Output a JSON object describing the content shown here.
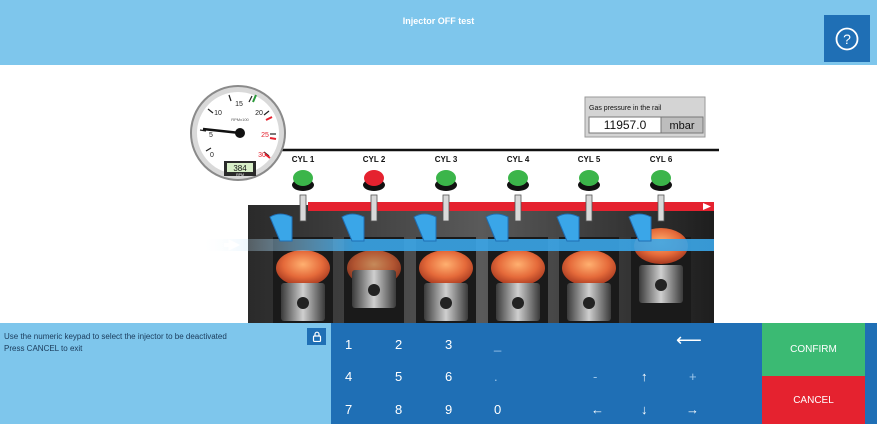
{
  "header": {
    "title": "Injector OFF test",
    "help_icon": "question-mark-icon"
  },
  "gauge": {
    "unit_label": "RPMx100",
    "rpm_label": "RPM",
    "rpm_value": "384",
    "ticks": [
      "0",
      "5",
      "10",
      "15",
      "20",
      "25",
      "30"
    ]
  },
  "pressure": {
    "label": "Gas pressure in the rail",
    "value": "11957.0",
    "unit": "mbar"
  },
  "cylinders": [
    {
      "label": "CYL 1",
      "status_color": "#3bb54a"
    },
    {
      "label": "CYL 2",
      "status_color": "#e5222f"
    },
    {
      "label": "CYL 3",
      "status_color": "#3bb54a"
    },
    {
      "label": "CYL 4",
      "status_color": "#3bb54a"
    },
    {
      "label": "CYL 5",
      "status_color": "#3bb54a"
    },
    {
      "label": "CYL 6",
      "status_color": "#3bb54a"
    }
  ],
  "instructions": {
    "line1": "Use the numeric keypad to select the injector to be deactivated",
    "line2": "Press CANCEL to exit",
    "lock_icon": "lock-icon"
  },
  "keypad": {
    "row1": [
      "1",
      "2",
      "3",
      "_"
    ],
    "row2": [
      "4",
      "5",
      "6",
      ".",
      "-",
      "↑",
      "+"
    ],
    "row3": [
      "7",
      "8",
      "9",
      "0",
      "←",
      "↓",
      "→"
    ],
    "backspace": "⟵"
  },
  "actions": {
    "confirm": "CONFIRM",
    "cancel": "CANCEL"
  },
  "colors": {
    "header": "#7ec6ec",
    "keypad": "#1f6fb5",
    "confirm": "#3bba73",
    "cancel": "#e5222f",
    "rail": "#e5222f",
    "flow": "#3aa6e8"
  }
}
